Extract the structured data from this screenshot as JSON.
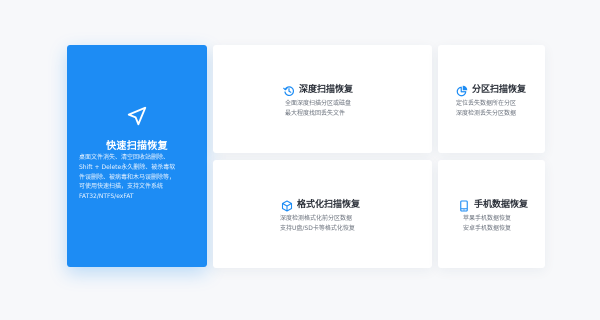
{
  "colors": {
    "accent": "#1d8cf4",
    "page_bg": "#f7f8fa",
    "card_bg": "#ffffff",
    "title_text": "#2a2f38",
    "body_text": "#6a717c"
  },
  "featured": {
    "icon": "navigation-arrow-icon",
    "title": "快速扫描恢复",
    "desc": [
      "桌面文件消失、清空回收站删除、",
      "Shift + Delete永久删除、被杀毒软",
      "件误删除、被病毒和木马误删除等，",
      "可使用快速扫描，支持文件系统",
      "FAT32/NTFS/exFAT"
    ]
  },
  "cards": {
    "deep": {
      "icon": "history-clock-icon",
      "title": "深度扫描恢复",
      "lines": [
        "全面深度扫描分区或磁盘",
        "最大程度找回丢失文件"
      ]
    },
    "partition": {
      "icon": "partition-pie-icon",
      "title": "分区扫描恢复",
      "lines": [
        "定位丢失数据所在分区",
        "深度检测丢失分区数据"
      ]
    },
    "format": {
      "icon": "cube-icon",
      "title": "格式化扫描恢复",
      "lines": [
        "深度检测格式化前分区数据",
        "支持U盘/SD卡等格式化恢复"
      ]
    },
    "phone": {
      "icon": "mobile-phone-icon",
      "title": "手机数据恢复",
      "lines": [
        "苹果手机数据恢复",
        "安卓手机数据恢复"
      ]
    }
  }
}
